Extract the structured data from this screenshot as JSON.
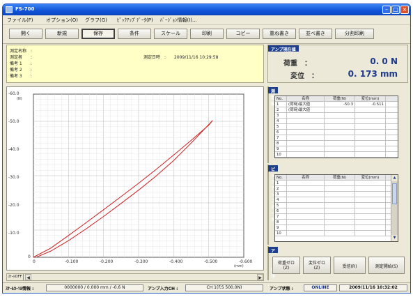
{
  "window": {
    "title": "FS-700"
  },
  "menu": [
    "ファイル(F)",
    "オプション(O)",
    "グラフ(G)",
    "ﾋﾟｯｸｱｯﾌﾟﾃﾞｰﾀ(P)",
    "ﾊﾞｰｼﾞｮﾝ情報(I)..."
  ],
  "toolbar": [
    "開く",
    "新規",
    "保存",
    "条件",
    "スケール",
    "印刷",
    "コピー",
    "重ね書き",
    "並べ書き",
    "分割印刷"
  ],
  "info": {
    "rows": [
      "測定名称　:",
      "測定者　　:",
      "備考 1　　:",
      "備考 2　　:",
      "備考 3　　:"
    ],
    "date_label": "測定日時　:",
    "date_value": "2009/11/16  10:29:58"
  },
  "current": {
    "title": "アンプ現在値",
    "load_label": "荷重　：",
    "load_value": "0. 0 N",
    "disp_label": "変位　：",
    "disp_value": "0. 173 mm"
  },
  "measured": {
    "title": "測定値",
    "headers": [
      "No.",
      "名称",
      "荷重(N)",
      "変位(mm)"
    ],
    "rows": [
      [
        "1",
        "(荷時)最大値",
        "-50.3",
        "-0.511"
      ],
      [
        "2",
        "(荷時)最大値",
        "",
        ""
      ],
      [
        "3",
        "",
        "",
        ""
      ],
      [
        "4",
        "",
        "",
        ""
      ],
      [
        "5",
        "",
        "",
        ""
      ],
      [
        "6",
        "",
        "",
        ""
      ],
      [
        "7",
        "",
        "",
        ""
      ],
      [
        "8",
        "",
        "",
        ""
      ],
      [
        "9",
        "",
        "",
        ""
      ],
      [
        "10",
        "",
        "",
        ""
      ]
    ]
  },
  "pickup": {
    "title": "ピックアップデータ",
    "headers": [
      "No.",
      "名称",
      "荷重(N)",
      "変位(mm)"
    ],
    "rows": [
      [
        "1",
        "",
        "",
        ""
      ],
      [
        "2",
        "",
        "",
        ""
      ],
      [
        "3",
        "",
        "",
        ""
      ],
      [
        "4",
        "",
        "",
        ""
      ],
      [
        "5",
        "",
        "",
        ""
      ],
      [
        "6",
        "",
        "",
        ""
      ],
      [
        "7",
        "",
        "",
        ""
      ],
      [
        "8",
        "",
        "",
        ""
      ],
      [
        "9",
        "",
        "",
        ""
      ],
      [
        "10",
        "",
        "",
        ""
      ]
    ]
  },
  "amp_ops": {
    "title": "アンプ操作",
    "buttons": [
      [
        "荷重ゼロ",
        "(Z)"
      ],
      [
        "変位ゼロ",
        "(Z)"
      ],
      [
        "受信(R)"
      ],
      [
        "測定開始(S)"
      ]
    ]
  },
  "scrollbar": {
    "scale_off": "ｽｹｰﾙOFF"
  },
  "status": {
    "scale_label": "ｽｹｰﾙｶｰｿﾙ情報 :",
    "scale_value": "0000000 / 0.000 mm / -0.6 N",
    "amp_ch_label": "アンプ入力CH :",
    "amp_ch_value": "CH 1(F.S 500.0N)",
    "amp_state_label": "アンプ状態 :",
    "amp_state_value": "ONLINE",
    "datetime": "2009/11/16 10:32:02"
  },
  "chart_data": {
    "type": "line",
    "xlabel": "(mm)",
    "ylabel": "(N)",
    "x_ticks": [
      "0",
      "-0.100",
      "-0.200",
      "-0.300",
      "-0.400",
      "-0.500",
      "-0.600"
    ],
    "y_ticks": [
      "-60.0",
      "-50.0",
      "-40.0",
      "-30.0",
      "-20.0",
      "-10.0",
      "0"
    ],
    "xlim": [
      0,
      -0.6
    ],
    "ylim": [
      0,
      -60
    ],
    "grid": true,
    "color": "#cc1f1f",
    "series": [
      {
        "x": [
          0,
          -0.05,
          -0.1,
          -0.15,
          -0.2,
          -0.25,
          -0.3,
          -0.35,
          -0.4,
          -0.45,
          -0.5,
          -0.511
        ],
        "y": [
          0,
          -3.4,
          -8.0,
          -12.7,
          -17.5,
          -22.3,
          -27.2,
          -32.3,
          -37.6,
          -43.0,
          -48.6,
          -50.3
        ]
      },
      {
        "x": [
          -0.511,
          -0.5,
          -0.45,
          -0.4,
          -0.35,
          -0.3,
          -0.25,
          -0.2,
          -0.15,
          -0.1,
          -0.05,
          -0.01
        ],
        "y": [
          -50.3,
          -48.8,
          -42.0,
          -35.6,
          -29.9,
          -24.7,
          -19.8,
          -15.0,
          -10.4,
          -6.1,
          -2.3,
          -0.1
        ]
      }
    ]
  }
}
